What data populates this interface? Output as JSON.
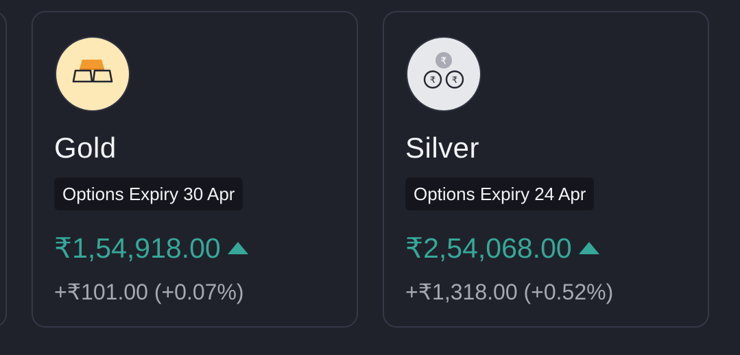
{
  "colors": {
    "background": "#20222b",
    "card_border": "#353846",
    "price_up": "#35a899",
    "muted_text": "#a6a8b2",
    "chip_bg": "#15161d"
  },
  "cards": [
    {
      "name": "Gold",
      "icon": "gold-bars-icon",
      "expiry": "Options Expiry 30 Apr",
      "price": "₹1,54,918.00",
      "trend": "up",
      "change": "+₹101.00 (+0.07%)"
    },
    {
      "name": "Silver",
      "icon": "rupee-coins-icon",
      "expiry": "Options Expiry 24 Apr",
      "price": "₹2,54,068.00",
      "trend": "up",
      "change": "+₹1,318.00 (+0.52%)"
    }
  ]
}
